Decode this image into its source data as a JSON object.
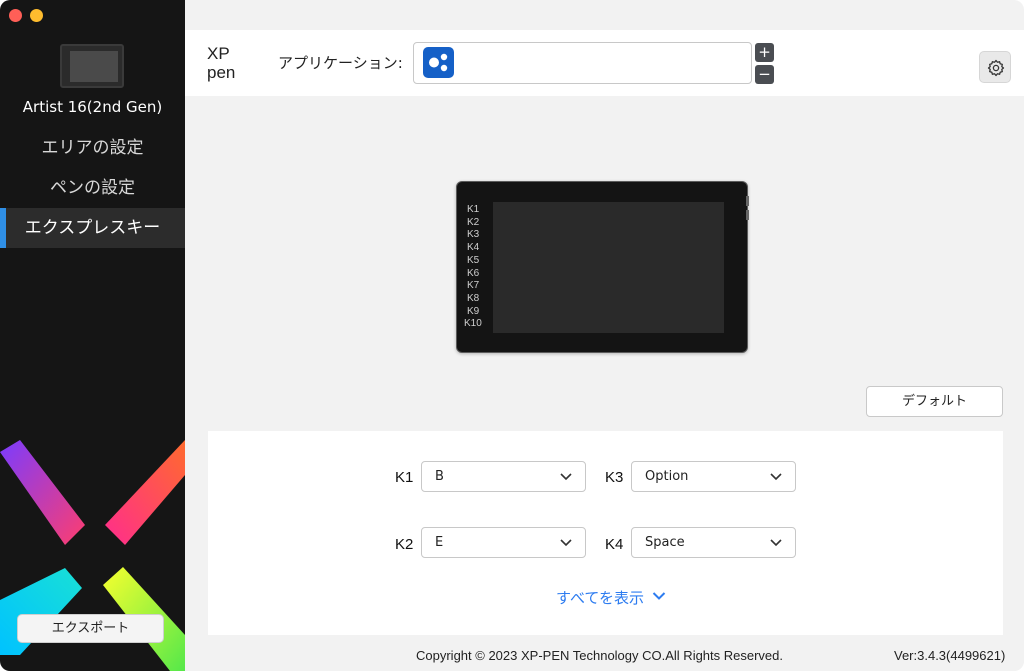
{
  "sidebar": {
    "device_name": "Artist 16(2nd Gen)",
    "items": [
      {
        "label": "エリアの設定"
      },
      {
        "label": "ペンの設定"
      },
      {
        "label": "エクスプレスキー"
      }
    ],
    "export_label": "エクスポート",
    "accent_color": "#2f8fe6"
  },
  "header": {
    "logo_text": "XP pen",
    "app_label": "アプリケーション:",
    "plus": "+",
    "minus": "−"
  },
  "tablet": {
    "keys": [
      "K1",
      "K2",
      "K3",
      "K4",
      "K5",
      "K6",
      "K7",
      "K8",
      "K9",
      "K10"
    ]
  },
  "default_label": "デフォルト",
  "keys": [
    {
      "id": "K1",
      "value": "B"
    },
    {
      "id": "K3",
      "value": "Option"
    },
    {
      "id": "K2",
      "value": "E"
    },
    {
      "id": "K4",
      "value": "Space"
    }
  ],
  "show_all": "すべてを表示",
  "footer": {
    "copyright": "Copyright © 2023  XP-PEN Technology CO.All Rights Reserved.",
    "version": "Ver:3.4.3(4499621)"
  }
}
